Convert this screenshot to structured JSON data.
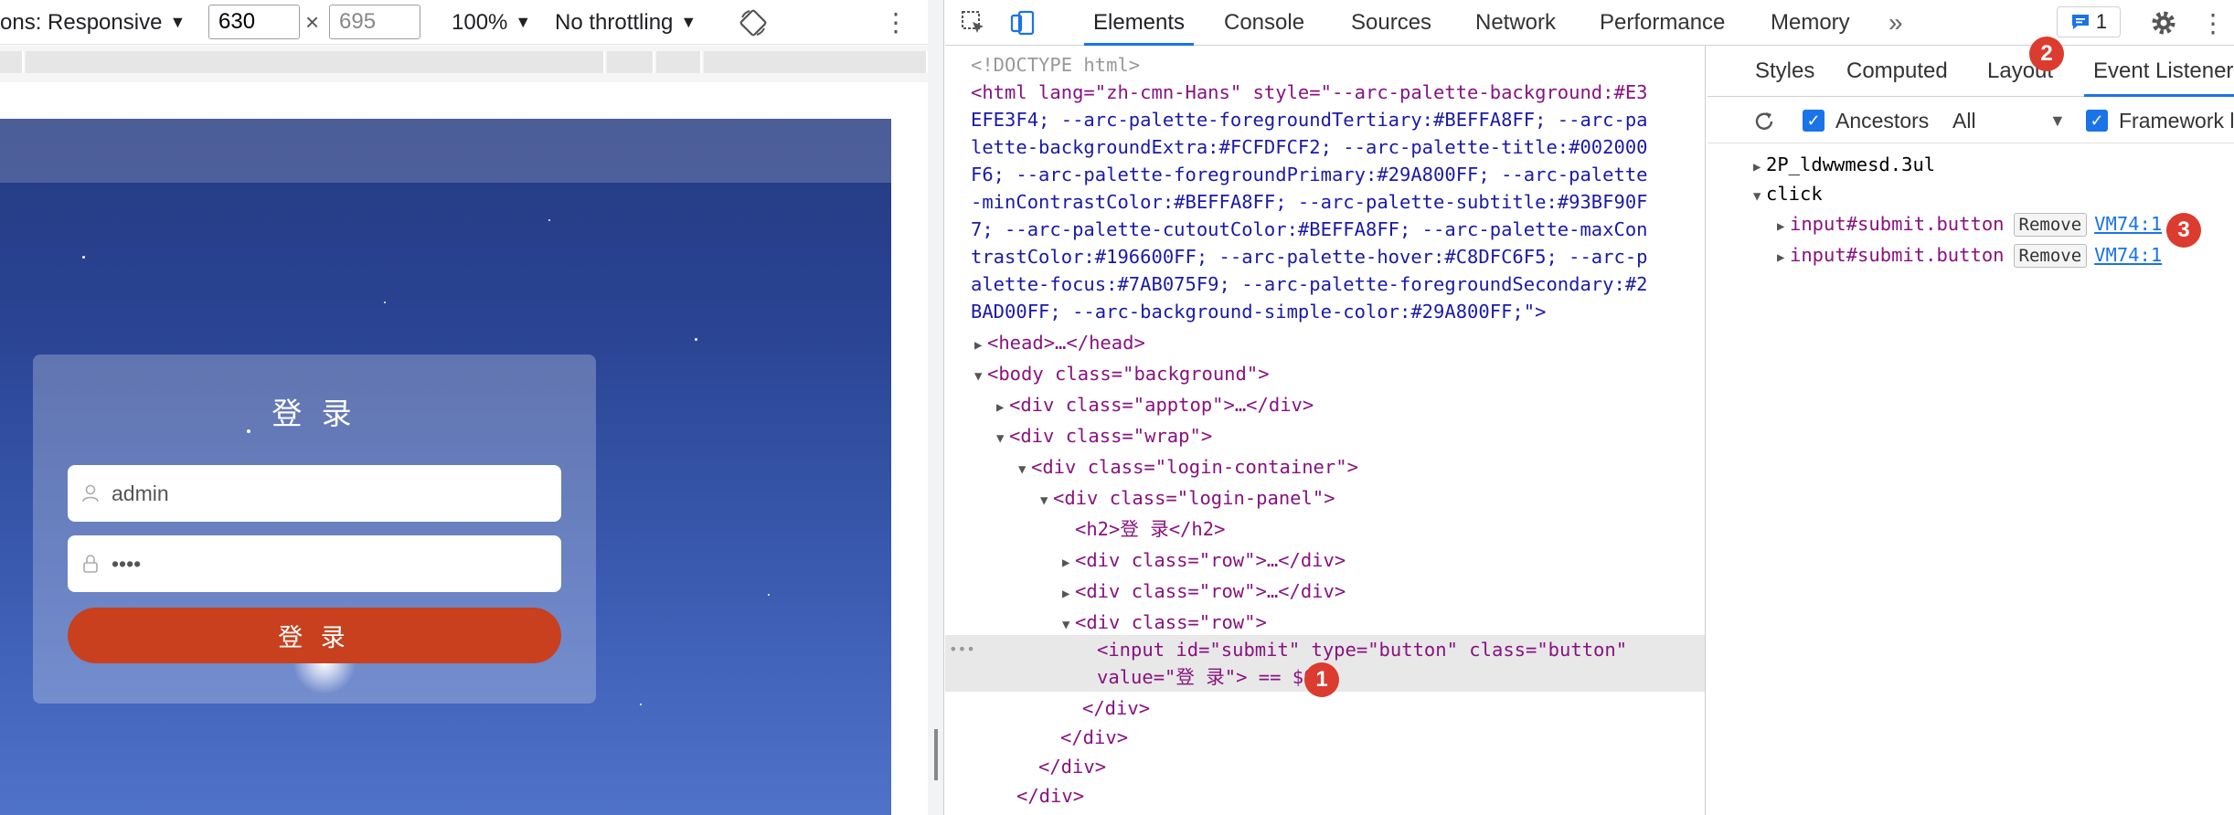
{
  "device_toolbar": {
    "dimensions_label": "ons: Responsive",
    "width_value": "630",
    "height_placeholder": "695",
    "times": "×",
    "zoom": "100%",
    "throttling": "No throttling"
  },
  "page": {
    "login_title": "登 录",
    "username_value": "admin",
    "password_value": "••••",
    "login_button": "登 录"
  },
  "devtools": {
    "tabs": [
      "Elements",
      "Console",
      "Sources",
      "Network",
      "Performance",
      "Memory"
    ],
    "more_tabs": "»",
    "message_count": "1",
    "dom_lines": {
      "doctype": "<!DOCTYPE html>",
      "html_1": "<html lang=\"zh-cmn-Hans\" style=\"--arc-palette-background:#E3",
      "html_2": "EFE3F4; --arc-palette-foregroundTertiary:#BEFFA8FF; --arc-pa",
      "html_3": "lette-backgroundExtra:#FCFDFCF2; --arc-palette-title:#002000",
      "html_4": "F6; --arc-palette-foregroundPrimary:#29A800FF; --arc-palette",
      "html_5": "-minContrastColor:#BEFFA8FF; --arc-palette-subtitle:#93BF90F",
      "html_6": "7; --arc-palette-cutoutColor:#BEFFA8FF; --arc-palette-maxCon",
      "html_7": "trastColor:#196600FF; --arc-palette-hover:#C8DFC6F5; --arc-p",
      "html_8": "alette-focus:#7AB075F9; --arc-palette-foregroundSecondary:#2",
      "html_9": "BAD00FF; --arc-background-simple-color:#29A800FF;\">",
      "head": "<head>…</head>",
      "body_open": "<body class=\"background\">",
      "apptop": "<div class=\"apptop\">…</div>",
      "wrap": "<div class=\"wrap\">",
      "login_container": "<div class=\"login-container\">",
      "login_panel": "<div class=\"login-panel\">",
      "h2": "<h2>登 录</h2>",
      "row1": "<div class=\"row\">…</div>",
      "row2": "<div class=\"row\">…</div>",
      "row3": "<div class=\"row\">",
      "input_1": "<input id=\"submit\" type=\"button\" class=\"button\"",
      "input_2": "value=\"登 录\"> == $0",
      "close_div_1": "</div>",
      "close_div_2": "</div>",
      "close_div_3": "</div>",
      "close_div_4": "</div>"
    },
    "selected_dots": "•••",
    "sidebar_tabs": [
      "Styles",
      "Computed",
      "Layout",
      "Event Listeners"
    ],
    "ancestors_label": "Ancestors",
    "filter_value": "All",
    "framework_label": "Framework list",
    "events": {
      "group_1": "2P_ldwwmesd.3ul",
      "group_2": "click",
      "listeners": [
        {
          "selector": "input#submit.button",
          "remove": "Remove",
          "source": "VM74:1"
        },
        {
          "selector": "input#submit.button",
          "remove": "Remove",
          "source": "VM74:1"
        }
      ]
    }
  },
  "markers": [
    "1",
    "2",
    "3"
  ],
  "colors": {
    "accent": "#1a73e8",
    "marker": "#dc3b2f",
    "login_button": "#c8401e",
    "page_bg": "#2a4493"
  }
}
